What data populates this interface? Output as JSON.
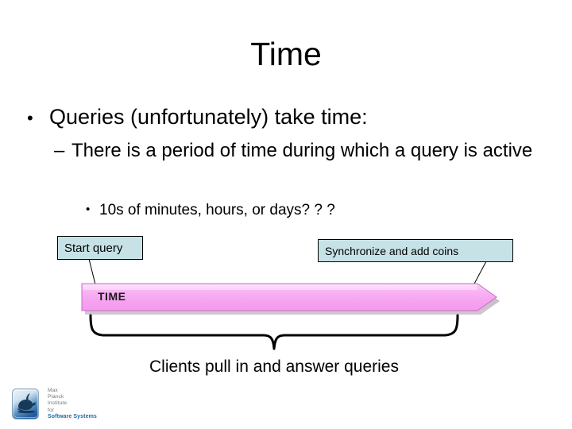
{
  "slide": {
    "title": "Time",
    "background_color": "#ffffff"
  },
  "body": {
    "level1": {
      "bullet_glyph": "•",
      "text": "Queries (unfortunately) take time:"
    },
    "level2": {
      "bullet_glyph": "–",
      "text": "There is a period of time during which a query is active"
    },
    "level3": {
      "bullet_glyph": "•",
      "text": "10s of minutes, hours, or days? ? ?"
    }
  },
  "diagram": {
    "callout_start": {
      "label": "Start query",
      "fill_color": "#c6e2e7",
      "border_color": "#000000"
    },
    "callout_sync": {
      "label": "Synchronize and add coins",
      "fill_color": "#c6e2e7",
      "border_color": "#000000"
    },
    "time_arrow": {
      "label": "TIME",
      "fill_color": "#f6a3f0",
      "highlight_color": "#fde0fb",
      "border_color": "#c36fc0",
      "direction": "right"
    },
    "brace": {
      "color": "#000000",
      "orientation": "down"
    },
    "caption": "Clients pull in and answer queries"
  },
  "footer": {
    "logo": {
      "icon": "oil-lamp-icon",
      "tile_color": "#2f74b5",
      "line1": "Max",
      "line2": "Planck",
      "line3": "Institute",
      "line4": "for",
      "line5": "Software Systems",
      "text_color": "#6e7577",
      "accent_color": "#1c6aa8"
    }
  }
}
